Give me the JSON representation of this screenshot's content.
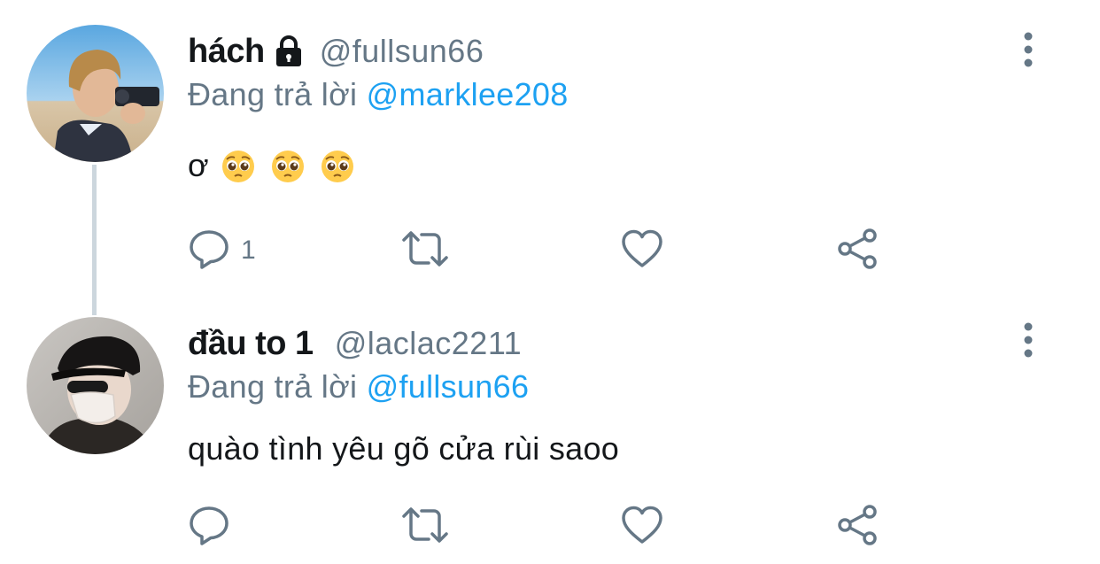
{
  "colors": {
    "primary_text": "#14171a",
    "secondary_text": "#657786",
    "accent": "#1da1f2",
    "thread_line": "#ccd6dd"
  },
  "tweets": [
    {
      "display_name": "hách",
      "protected_icon": "lock-icon",
      "handle": "@fullsun66",
      "reply_prefix": "Đang trả lời",
      "reply_to": "@marklee208",
      "text": "ơ",
      "emojis": [
        "pleading-face-emoji",
        "pleading-face-emoji",
        "pleading-face-emoji"
      ],
      "reply_count": "1",
      "icons": [
        "reply-icon",
        "retweet-icon",
        "like-icon",
        "share-icon",
        "more-icon"
      ]
    },
    {
      "display_name": "đầu to 1",
      "handle": "@laclac2211",
      "reply_prefix": "Đang trả lời",
      "reply_to": "@fullsun66",
      "text": "quào tình yêu gõ cửa rùi saoo",
      "reply_count": "",
      "icons": [
        "reply-icon",
        "retweet-icon",
        "like-icon",
        "share-icon",
        "more-icon"
      ]
    }
  ]
}
